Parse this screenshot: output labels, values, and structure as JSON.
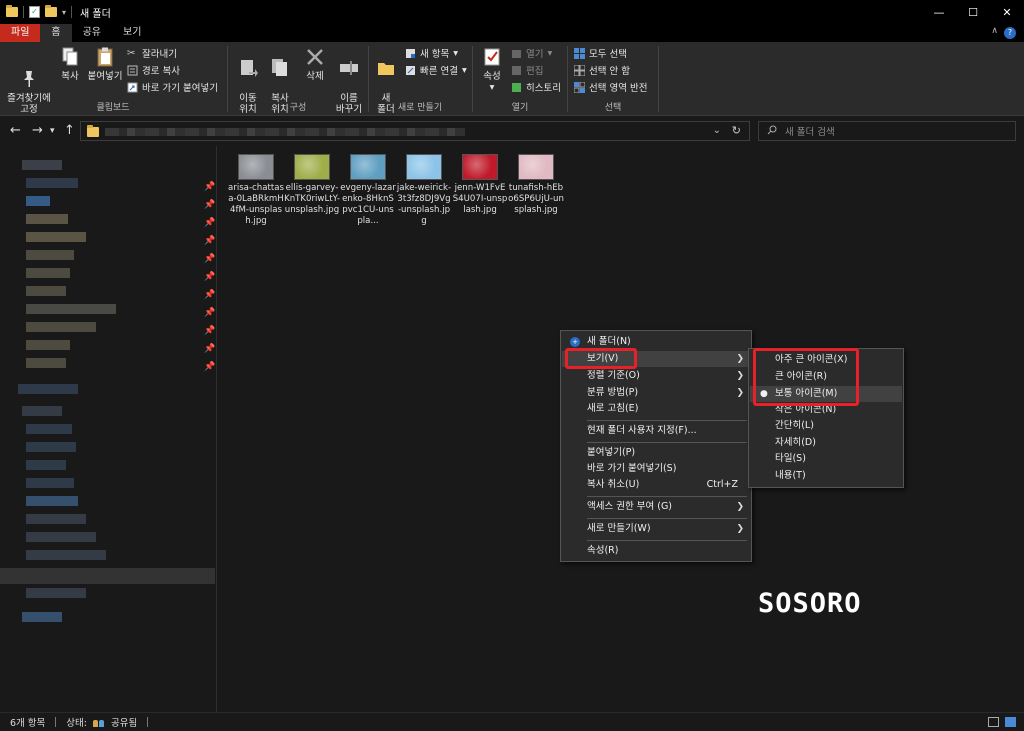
{
  "window": {
    "title": "새 폴더",
    "controls": {
      "minimize": "—",
      "maximize": "☐",
      "close": "✕"
    }
  },
  "ribbon_tabs": [
    "파일",
    "홈",
    "공유",
    "보기"
  ],
  "ribbon": {
    "clipboard": {
      "label": "클립보드",
      "pin": "즐겨찾기에\n고정",
      "copy": "복사",
      "paste": "붙여넣기",
      "cut": "잘라내기",
      "copy_path": "경로 복사",
      "paste_shortcut": "바로 가기 붙여넣기"
    },
    "organize": {
      "label": "구성",
      "move_to": "이동\n위치",
      "copy_to": "복사\n위치",
      "delete": "삭제",
      "rename": "이름\n바꾸기"
    },
    "new": {
      "label": "새로 만들기",
      "new_folder": "새\n폴더",
      "new_item": "새 항목",
      "easy_access": "빠른 연결"
    },
    "open": {
      "label": "열기",
      "properties": "속성",
      "open": "열기",
      "edit": "편집",
      "history": "히스토리"
    },
    "select": {
      "label": "선택",
      "select_all": "모두 선택",
      "select_none": "선택 안 함",
      "invert": "선택 영역 반전"
    }
  },
  "search": {
    "placeholder": "새 폴더 검색"
  },
  "files": [
    {
      "name": "arisa-chattasa-0LaBRkmH4fM-unsplash.jpg",
      "thumb_color": "#8a8d93"
    },
    {
      "name": "ellis-garvey-KnTK0riwLtY-unsplash.jpg",
      "thumb_color": "#9fae48"
    },
    {
      "name": "evgeny-lazarenko-8HknSpvc1CU-unspla...",
      "thumb_color": "#5f9fc2"
    },
    {
      "name": "jake-weirick-3t3fz8DJ9Vg-unsplash.jpg",
      "thumb_color": "#8cc3e8"
    },
    {
      "name": "jenn-W1FvES4U07I-unsplash.jpg",
      "thumb_color": "#c01a2a"
    },
    {
      "name": "tunafish-hEbo6SP6UjU-unsplash.jpg",
      "thumb_color": "#e0b9c2"
    }
  ],
  "context_menu": {
    "new_folder": "새 폴더(N)",
    "view": "보기(V)",
    "sort_by": "정렬 기준(O)",
    "group_by": "분류 방법(P)",
    "refresh": "새로 고침(E)",
    "customize": "현재 폴더 사용자 지정(F)...",
    "paste": "붙여넣기(P)",
    "paste_shortcut": "바로 가기 붙여넣기(S)",
    "undo_copy": "복사 취소(U)",
    "undo_shortcut": "Ctrl+Z",
    "give_access": "액세스 권한 부여 (G)",
    "new": "새로 만들기(W)",
    "properties": "속성(R)"
  },
  "view_submenu": {
    "extra_large": "아주 큰 아이콘(X)",
    "large": "큰 아이콘(R)",
    "medium": "보통 아이콘(M)",
    "small": "작은 아이콘(N)",
    "list": "간단히(L)",
    "details": "자세히(D)",
    "tiles": "타일(S)",
    "content": "내용(T)",
    "selected": "보통 아이콘(M)"
  },
  "watermark": "SOSORO",
  "status": {
    "count": "6개 항목",
    "state_label": "상태:",
    "state_value": "공유됨"
  }
}
